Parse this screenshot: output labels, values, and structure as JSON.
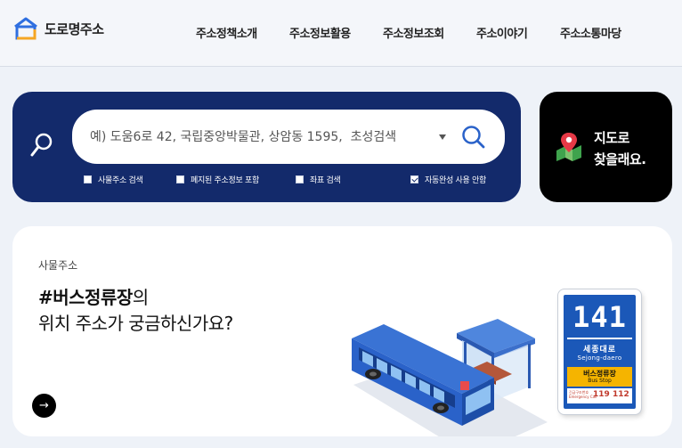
{
  "header": {
    "logo_text": "도로명주소",
    "nav": [
      {
        "label": "주소정책소개"
      },
      {
        "label": "주소정보활용"
      },
      {
        "label": "주소정보조회"
      },
      {
        "label": "주소이야기"
      },
      {
        "label": "주소소통마당"
      }
    ]
  },
  "search": {
    "placeholder": "예) 도움6로 42, 국립중앙박물관, 상암동 1595,  초성검색",
    "options": [
      {
        "label": "사물주소 검색",
        "checked": false
      },
      {
        "label": "폐지된 주소정보 포함",
        "checked": false
      },
      {
        "label": "좌표 검색",
        "checked": false
      },
      {
        "label": "자동완성 사용 안함",
        "checked": true
      }
    ]
  },
  "map_button": {
    "line1": "지도로",
    "line2": "찾을래요."
  },
  "promo": {
    "category": "사물주소",
    "title_highlight": "#버스정류장",
    "title_suffix": "의",
    "title_line2": "위치 주소가 궁금하신가요?",
    "arrow": "→"
  },
  "bus_sign": {
    "number": "141",
    "road_ko": "세종대로",
    "road_en": "Sejong-daero",
    "stop_ko": "버스정류장",
    "stop_en": "Bus Stop",
    "tiny_line1": "긴급구조번호",
    "tiny_line2": "Emergency Call",
    "range_start": "119",
    "range_end": "112"
  },
  "colors": {
    "search_panel": "#132a6b",
    "bus_blue": "#2a62c9",
    "sign_blue": "#1b58b8",
    "sign_yellow": "#f5b400"
  }
}
